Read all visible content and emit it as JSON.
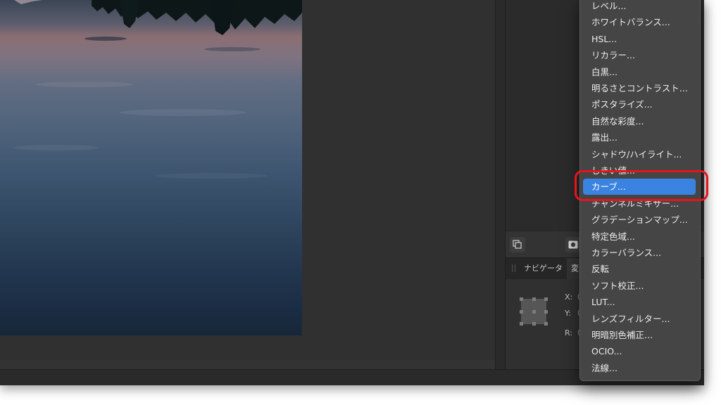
{
  "panel_tabs": {
    "navigator": "ナビゲータ",
    "transform": "変"
  },
  "transform_panel": {
    "x_label": "X:",
    "y_label": "Y:",
    "r_label": "R:",
    "x_value": "0",
    "y_value": "0",
    "r_value": "0"
  },
  "menu": {
    "items": [
      "レベル...",
      "ホワイトバランス...",
      "HSL...",
      "リカラー...",
      "白黒...",
      "明るさとコントラスト...",
      "ポスタライズ...",
      "自然な彩度...",
      "露出...",
      "シャドウ/ハイライト...",
      "しきい値...",
      "カーブ...",
      "チャンネルミキサー...",
      "グラデーションマップ...",
      "特定色域...",
      "カラーバランス...",
      "反転",
      "ソフト校正...",
      "LUT...",
      "レンズフィルター...",
      "明暗別色補正...",
      "OCIO...",
      "法線..."
    ],
    "selected_index": 11
  },
  "colors": {
    "selection": "#3b83e0",
    "annotation_ring": "#e8141c",
    "menu_background": "#454545",
    "app_background": "#2b2b2b"
  },
  "icons": {
    "layer_toolbar_left": "duplicate-layers-icon",
    "layer_toolbar_mask": "mask-icon"
  }
}
